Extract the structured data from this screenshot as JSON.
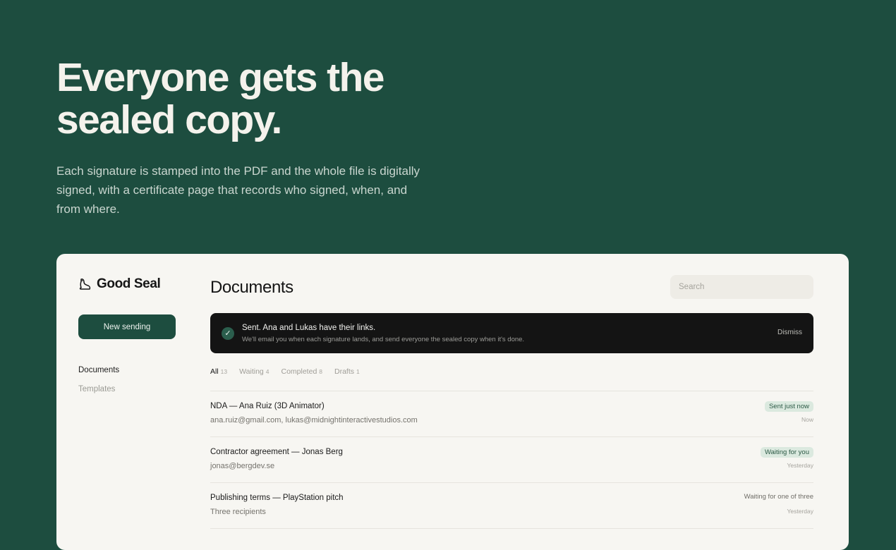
{
  "hero": {
    "title_line1": "Everyone gets the",
    "title_line2": "sealed copy.",
    "subtitle": "Each signature is stamped into the PDF and the whole file is digitally signed, with a certificate page that records who signed, when, and from where."
  },
  "app": {
    "brand": {
      "name": "Good Seal",
      "icon": "seal-icon"
    },
    "new_sending_label": "New sending",
    "nav": [
      {
        "label": "Documents",
        "active": true
      },
      {
        "label": "Templates",
        "active": false
      }
    ],
    "page_title": "Documents",
    "search": {
      "placeholder": "Search",
      "value": ""
    },
    "toast": {
      "icon": "check-icon",
      "title": "Sent. Ana and Lukas have their links.",
      "body": "We'll email you when each signature lands, and send everyone the sealed copy when it's done.",
      "dismiss_label": "Dismiss"
    },
    "filters": [
      {
        "label": "All",
        "count": "13",
        "active": true
      },
      {
        "label": "Waiting",
        "count": "4",
        "active": false
      },
      {
        "label": "Completed",
        "count": "8",
        "active": false
      },
      {
        "label": "Drafts",
        "count": "1",
        "active": false
      }
    ],
    "documents": [
      {
        "title": "NDA — Ana Ruiz (3D Animator)",
        "recipients": "ana.ruiz@gmail.com, lukas@midnightinteractivestudios.com",
        "status": "Sent just now",
        "time": "Now"
      },
      {
        "title": "Contractor agreement — Jonas Berg",
        "recipients": "jonas@bergdev.se",
        "status": "Waiting for you",
        "time": "Yesterday"
      },
      {
        "title": "Publishing terms — PlayStation pitch",
        "recipients": "Three recipients",
        "status": "Waiting for one of three",
        "time": "Yesterday"
      }
    ]
  },
  "colors": {
    "background": "#1d4d3f",
    "card": "#f7f6f2",
    "accent": "#1d4d3f",
    "toast": "#141414",
    "status_pill_bg": "#dbe9df",
    "status_pill_text": "#2d5a46"
  }
}
